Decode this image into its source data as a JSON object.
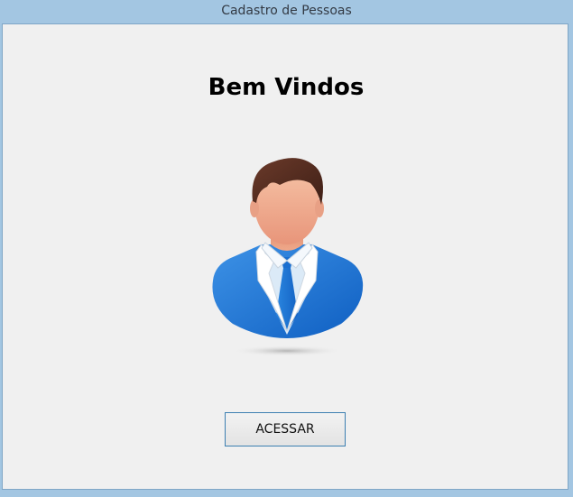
{
  "window": {
    "title": "Cadastro de Pessoas"
  },
  "main": {
    "heading": "Bem Vindos",
    "access_button_label": "ACESSAR"
  },
  "icons": {
    "avatar": "user-avatar-icon"
  },
  "colors": {
    "titlebar": "#a3c6e2",
    "background": "#f0f0f0",
    "button_border": "#3c7fb1",
    "suit_blue": "#1f78d8"
  }
}
